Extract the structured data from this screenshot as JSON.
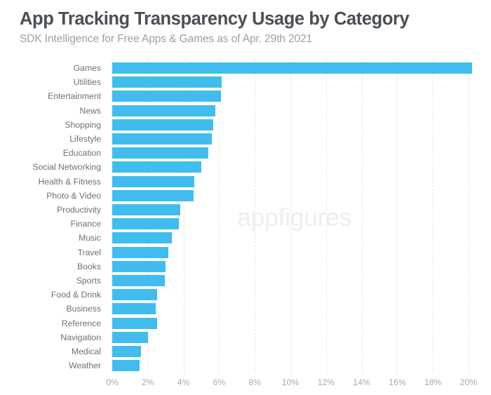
{
  "header": {
    "title": "App Tracking Transparency Usage by Category",
    "subtitle": "SDK Intelligence for Free Apps & Games as of Apr. 29th 2021"
  },
  "watermark": "appfigures",
  "colors": {
    "bar": "#40bdee",
    "title": "#4a4f55",
    "subtitle": "#9aa0a6",
    "label": "#6b7075",
    "tick": "#a4a9ae",
    "gridline": "#e2e4e6",
    "watermark": "#eceef0",
    "background": "#ffffff"
  },
  "chart_data": {
    "type": "bar",
    "orientation": "horizontal",
    "title": "App Tracking Transparency Usage by Category",
    "subtitle": "SDK Intelligence for Free Apps & Games as of Apr. 29th 2021",
    "xlabel": "",
    "ylabel": "",
    "xlim": [
      0,
      20.8
    ],
    "grid": "vertical-dashed",
    "legend": "none",
    "value_unit": "%",
    "xticks": [
      0,
      2,
      4,
      6,
      8,
      10,
      12,
      14,
      16,
      18,
      20
    ],
    "xticklabels": [
      "0%",
      "2%",
      "4%",
      "6%",
      "8%",
      "10%",
      "12%",
      "14%",
      "16%",
      "18%",
      "20%"
    ],
    "categories": [
      "Games",
      "Utilities",
      "Entertainment",
      "News",
      "Shopping",
      "Lifestyle",
      "Education",
      "Social Networking",
      "Health & Fitness",
      "Photo & Video",
      "Productivity",
      "Finance",
      "Music",
      "Travel",
      "Books",
      "Sports",
      "Food & Drink",
      "Business",
      "Reference",
      "Navigation",
      "Medical",
      "Weather"
    ],
    "values": [
      20.2,
      6.15,
      6.1,
      5.8,
      5.65,
      5.6,
      5.4,
      5.0,
      4.6,
      4.55,
      3.8,
      3.75,
      3.35,
      3.15,
      3.0,
      2.95,
      2.5,
      2.45,
      2.5,
      2.0,
      1.6,
      1.55
    ]
  }
}
